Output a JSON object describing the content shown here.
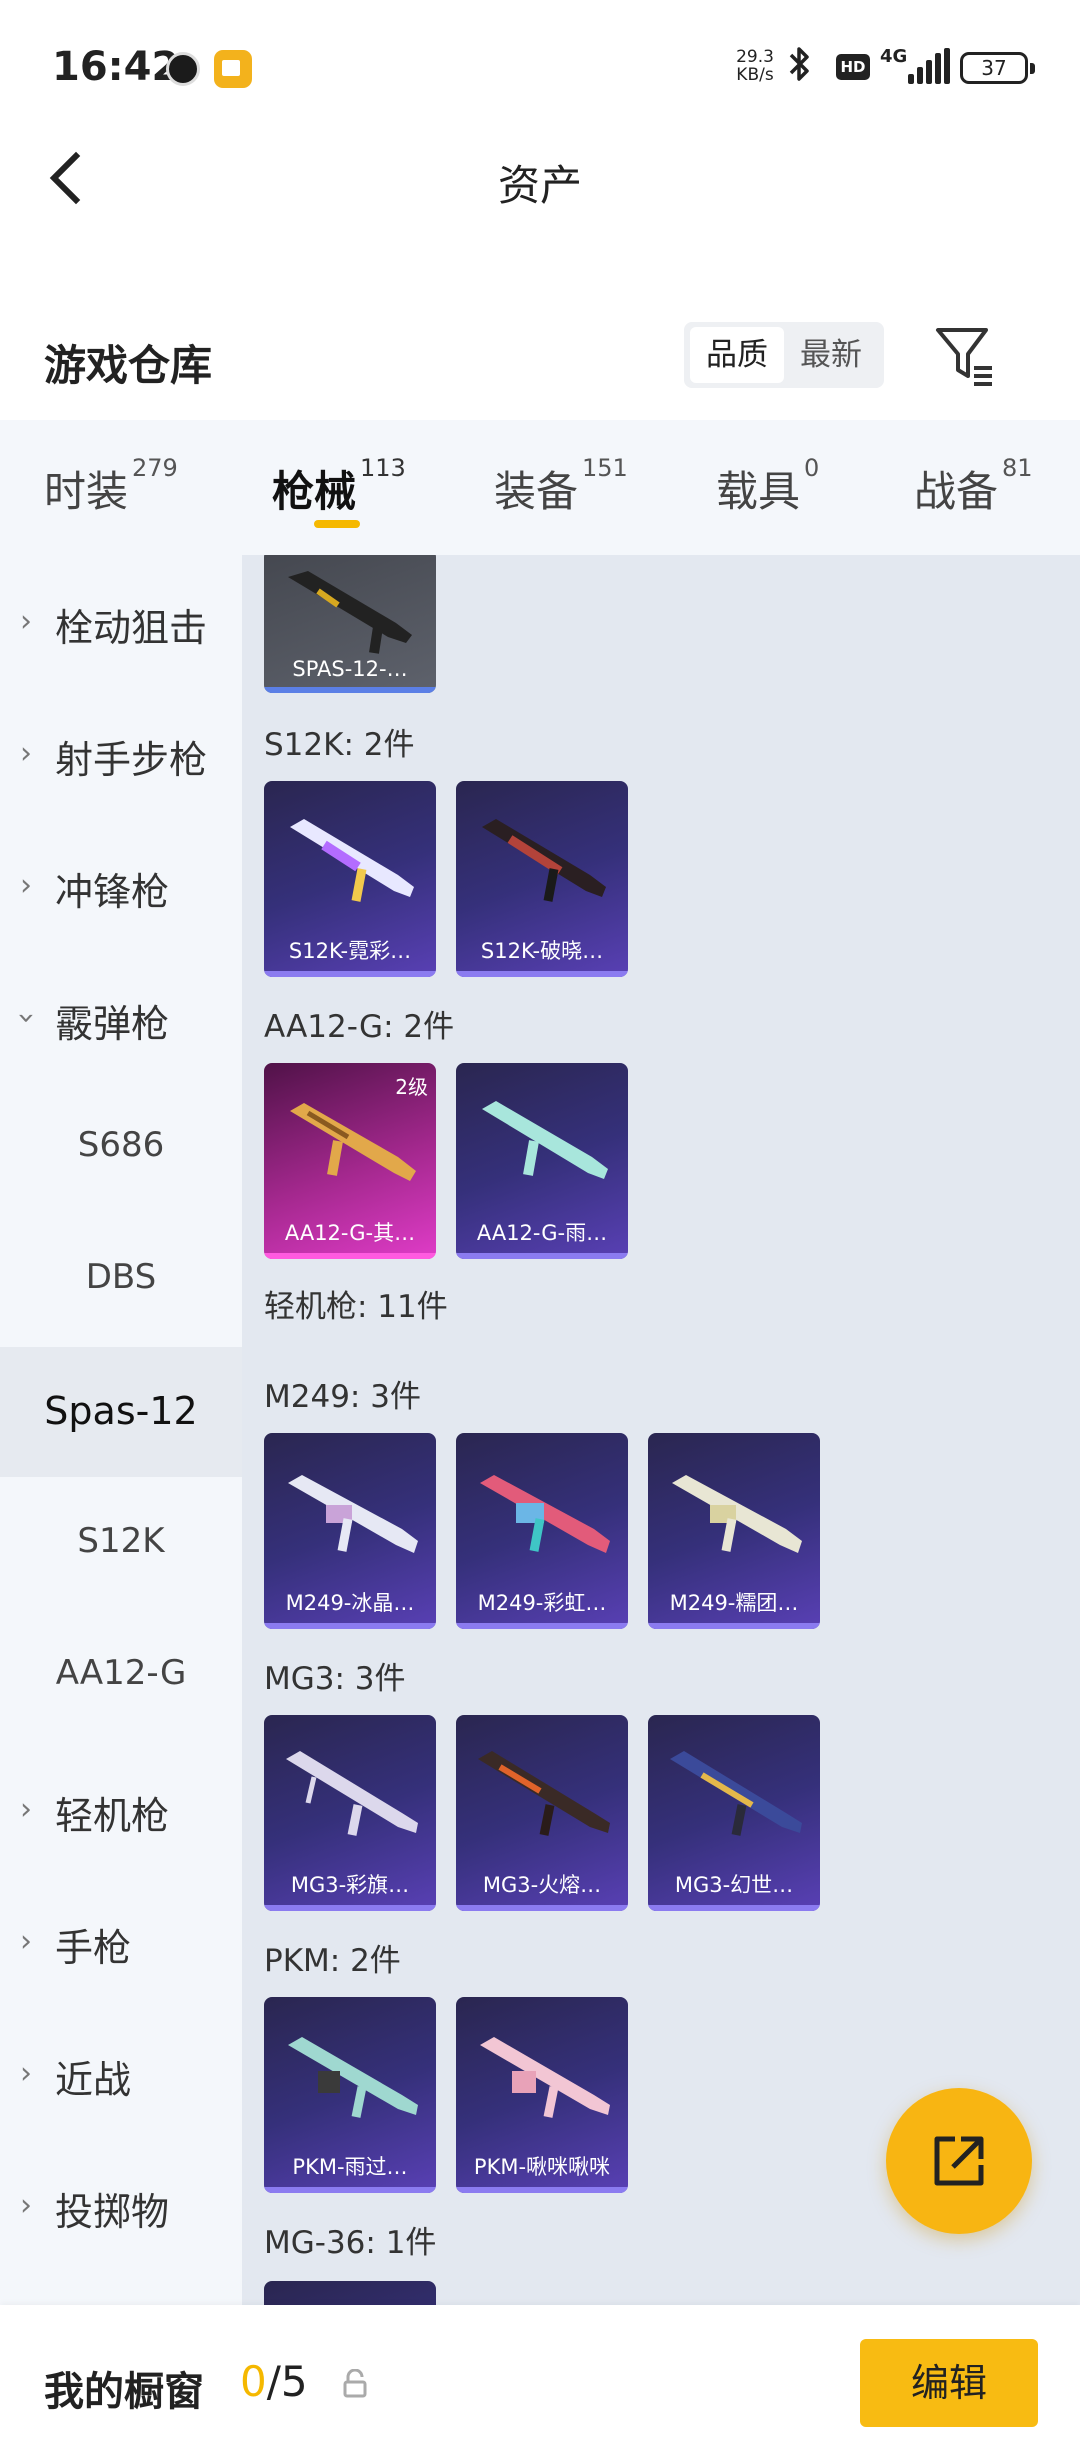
{
  "status_bar": {
    "time": "16:42",
    "network_speed_value": "29.3",
    "network_speed_unit": "KB/s",
    "hd": "HD",
    "network_type": "4G",
    "battery": "37",
    "bluetooth_icon": "bluetooth-icon",
    "app_icons": [
      "clock-app-icon",
      "notes-app-icon"
    ]
  },
  "header": {
    "title": "资产",
    "back_icon": "chevron-left-icon"
  },
  "warehouse": {
    "title": "游戏仓库",
    "sort_options": [
      "品质",
      "最新"
    ],
    "sort_selected": "品质",
    "filter_icon": "filter-icon"
  },
  "tabs": [
    {
      "label": "时装",
      "count": "279"
    },
    {
      "label": "枪械",
      "count": "113"
    },
    {
      "label": "装备",
      "count": "151"
    },
    {
      "label": "载具",
      "count": "0"
    },
    {
      "label": "战备",
      "count": "81"
    }
  ],
  "active_tab": "枪械",
  "sidebar": {
    "items": [
      {
        "label": "栓动狙击",
        "expandable": true
      },
      {
        "label": "射手步枪",
        "expandable": true
      },
      {
        "label": "冲锋枪",
        "expandable": true
      },
      {
        "label": "霰弹枪",
        "expandable": true,
        "expanded": true
      },
      {
        "label": "S686",
        "sub": true
      },
      {
        "label": "DBS",
        "sub": true
      },
      {
        "label": "Spas-12",
        "sub": true,
        "active": true
      },
      {
        "label": "S12K",
        "sub": true
      },
      {
        "label": "AA12-G",
        "sub": true
      },
      {
        "label": "轻机枪",
        "expandable": true
      },
      {
        "label": "手枪",
        "expandable": true
      },
      {
        "label": "近战",
        "expandable": true
      },
      {
        "label": "投掷物",
        "expandable": true
      }
    ]
  },
  "content": {
    "sections": [
      {
        "label": "",
        "items": [
          {
            "name": "SPAS-12-…",
            "rarity": "gray"
          }
        ]
      },
      {
        "label": "S12K: 2件",
        "items": [
          {
            "name": "S12K-霓彩…"
          },
          {
            "name": "S12K-破晓…"
          }
        ]
      },
      {
        "label": "AA12-G: 2件",
        "items": [
          {
            "name": "AA12-G-其…",
            "level": "2级",
            "rarity": "pink"
          },
          {
            "name": "AA12-G-雨…"
          }
        ]
      },
      {
        "label": "轻机枪: 11件",
        "items": []
      },
      {
        "label": "M249: 3件",
        "items": [
          {
            "name": "M249-冰晶…"
          },
          {
            "name": "M249-彩虹…"
          },
          {
            "name": "M249-糯团…"
          }
        ]
      },
      {
        "label": "MG3: 3件",
        "items": [
          {
            "name": "MG3-彩旗…"
          },
          {
            "name": "MG3-火熔…"
          },
          {
            "name": "MG3-幻世…"
          }
        ]
      },
      {
        "label": "PKM: 2件",
        "items": [
          {
            "name": "PKM-雨过…"
          },
          {
            "name": "PKM-啾咪啾咪"
          }
        ]
      },
      {
        "label": "MG-36: 1件",
        "items": [
          {
            "name": ""
          }
        ]
      }
    ]
  },
  "fab_icon": "share-out-icon",
  "bottom_bar": {
    "title": "我的橱窗",
    "count_current": "0",
    "count_total": "/5",
    "lock_icon": "lock-icon",
    "edit_label": "编辑"
  },
  "colors": {
    "accent": "#F8BB12",
    "card_purple": "#3A3280",
    "card_pink": "#C030B0",
    "card_gray": "#50535C"
  }
}
